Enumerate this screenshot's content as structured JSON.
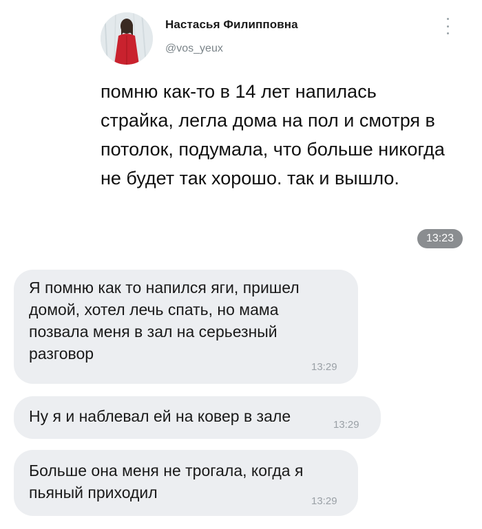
{
  "tweet": {
    "display_name": "Настасья Филипповна",
    "handle": "@vos_yeux",
    "text": "помню как-то в 14 лет напилась страйка, легла дома на пол и смотря в потолок, подумала, что больше никогда не будет так хорошо. так и вышло.",
    "avatar_icon": "avatar-girl-red-coat-icon",
    "more_icon": "vertical-dots-icon"
  },
  "time_pill": "13:23",
  "messages": [
    {
      "text": "Я помню как то напился яги, пришел\nдомой, хотел лечь спать, но мама\nпозвала меня в зал на серьезный\nразговор",
      "time": "13:29"
    },
    {
      "text": "Ну я и наблевал ей на ковер в зале",
      "time": "13:29"
    },
    {
      "text": "Больше она меня не трогала, когда я\nпьяный приходил",
      "time": "13:29"
    }
  ],
  "colors": {
    "bubble_bg": "#eceef1",
    "pill_bg": "#8a8d90",
    "handle": "#7b8489",
    "avatar_coat": "#c9222e"
  }
}
